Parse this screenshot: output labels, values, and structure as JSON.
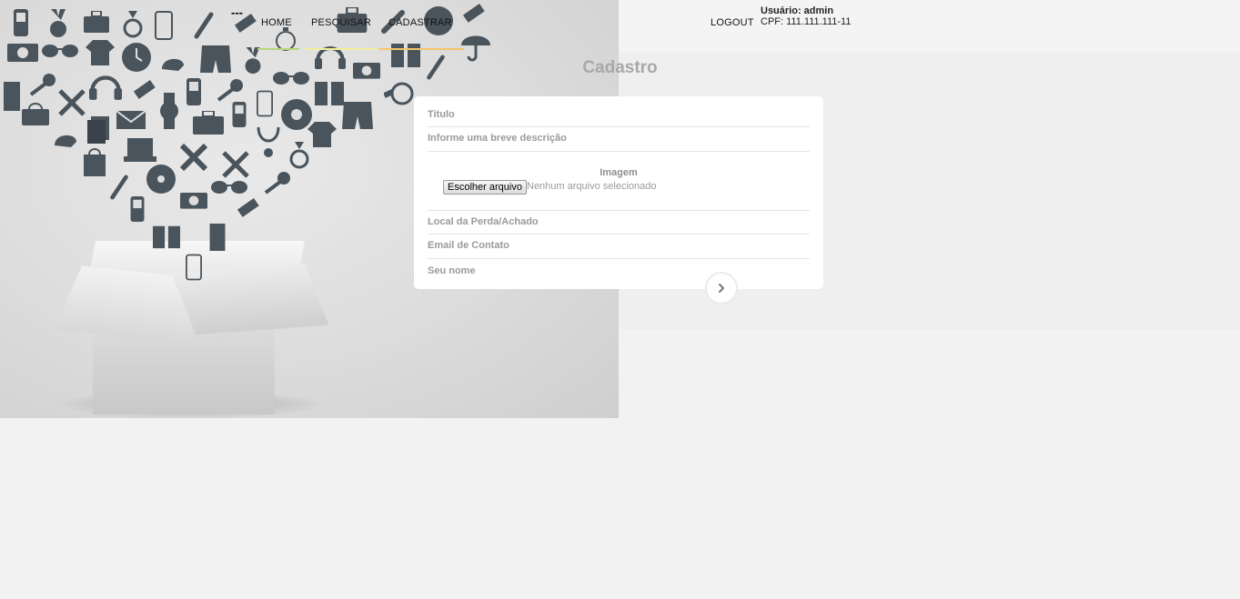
{
  "header": {
    "separator": "---",
    "nav": [
      {
        "label": "HOME"
      },
      {
        "label": "PESQUISAR"
      },
      {
        "label": "CADASTRAR"
      }
    ],
    "logout_label": "LOGOUT",
    "user_label": "Usuário: admin",
    "cpf_label": "CPF: 111.111.111-11",
    "accent_colors": [
      "#b7d77a",
      "#f2ee9a",
      "#f4c66a"
    ]
  },
  "main": {
    "title": "Cadastro",
    "form": {
      "titulo_placeholder": "Titulo",
      "descricao_placeholder": "Informe uma breve descrição",
      "imagem_label": "Imagem",
      "file_button_label": "Escolher arquivo",
      "file_status": "Nenhum arquivo selecionado",
      "local_placeholder": "Local da Perda/Achado",
      "email_placeholder": "Email de Contato",
      "nome_placeholder": "Seu nome",
      "next_icon": "chevron-right-icon"
    }
  },
  "background": {
    "illustration": "open-box-with-lost-items-icons"
  }
}
